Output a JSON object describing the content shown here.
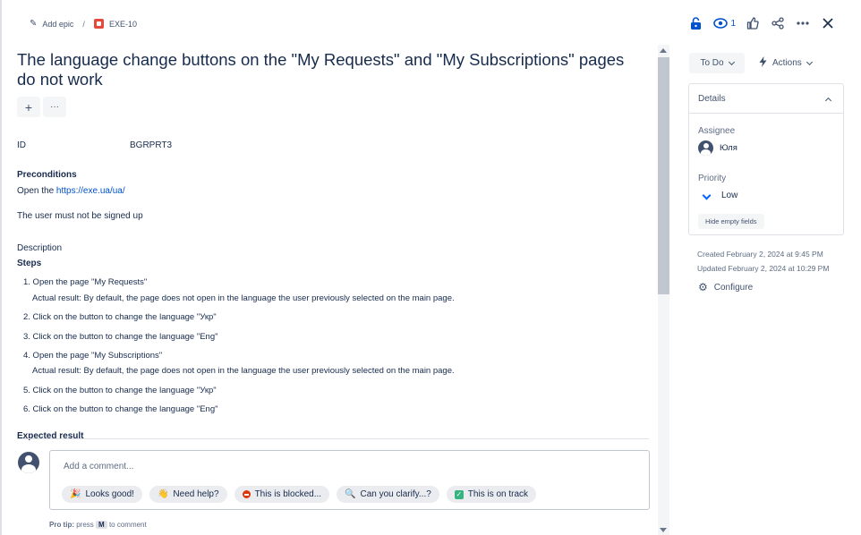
{
  "breadcrumb": {
    "add_epic": "Add epic",
    "separator": "/",
    "issue_key": "EXE-10"
  },
  "top_icons": {
    "lock": "lock-icon",
    "watch": "eye-icon",
    "watch_count": "1",
    "like": "thumbs-up-icon",
    "share": "share-icon",
    "more": "more-icon",
    "close": "close-icon"
  },
  "issue": {
    "title": "The language change buttons on the \"My Requests\" and \"My Subscriptions\" pages do not work",
    "add_button": "+",
    "more_button": "···",
    "id_label": "ID",
    "id_value": "BGRPRT3",
    "preconditions_label": "Preconditions",
    "precondition_open_prefix": "Open the ",
    "precondition_link": "https://exe.ua/ua/",
    "precondition_2": "The user must not be signed up",
    "description_label": "Description",
    "steps_label": "Steps",
    "steps": [
      "1. Open the page \"My Requests\"",
      "Actual result:  By default, the page does not open in the language the user previously selected on the main page.",
      "2. Click on the button to change the language \"Укр\"",
      "3. Click on the button to change the language \"Eng\"",
      "4. Open the page \"My Subscriptions\"",
      "Actual result: By default, the page does not open in the language the user previously selected on the main page.",
      "5. Click on the button to change the language \"Укр\"",
      "6. Click on the button to change the language \"Eng\""
    ],
    "expected_label": "Expected result"
  },
  "comment": {
    "placeholder": "Add a comment...",
    "chips": [
      {
        "emoji": "🎉",
        "label": "Looks good!"
      },
      {
        "emoji": "👋",
        "label": "Need help?"
      },
      {
        "emoji": "",
        "label": "This is blocked..."
      },
      {
        "emoji": "🔍",
        "label": "Can you clarify...?"
      },
      {
        "emoji": "",
        "label": "This is on track"
      }
    ],
    "protip_prefix": "Pro tip:",
    "protip_press": "press",
    "protip_key": "M",
    "protip_suffix": "to comment"
  },
  "sidebar": {
    "status": "To Do",
    "actions": "Actions",
    "details_title": "Details",
    "assignee_label": "Assignee",
    "assignee_value": "Юля",
    "priority_label": "Priority",
    "priority_value": "Low",
    "hide_empty": "Hide empty fields",
    "created": "Created February 2, 2024 at 9:45 PM",
    "updated": "Updated February 2, 2024 at 10:29 PM",
    "configure": "Configure"
  },
  "colors": {
    "accent": "#0052cc",
    "issue_icon": "#e5493a",
    "on_track": "#36b37e",
    "blocked": "#de350b"
  }
}
